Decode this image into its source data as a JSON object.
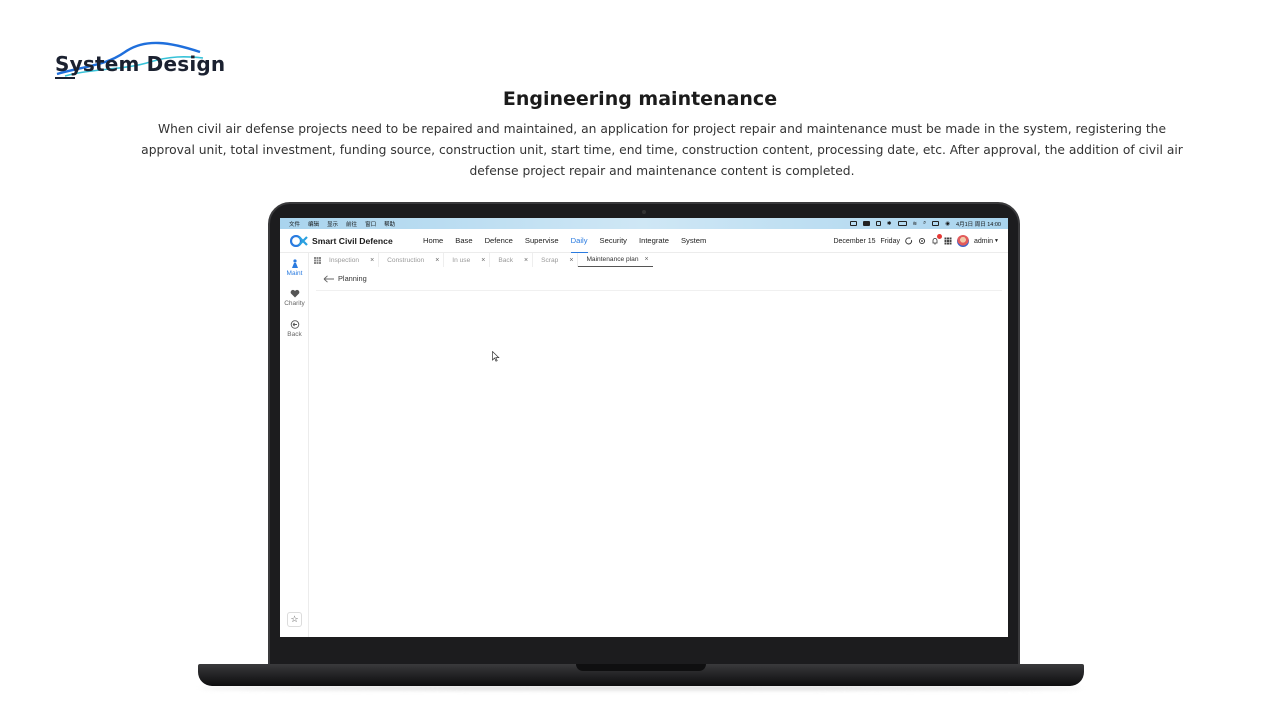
{
  "brand": {
    "title": "System Design"
  },
  "page": {
    "heading": "Engineering maintenance",
    "description": "When civil air defense projects need to be repaired and maintained, an application for project repair and maintenance must be made in the system, registering the approval unit, total investment, funding source, construction unit, start time, end time, construction content, processing date, etc. After approval, the addition of civil air defense project repair and maintenance content is completed."
  },
  "menubar": {
    "items": [
      "文件",
      "编辑",
      "显示",
      "前往",
      "窗口",
      "帮助"
    ],
    "clock": "4月1日 周日  14:00"
  },
  "app": {
    "name": "Smart Civil Defence",
    "nav": [
      "Home",
      "Base",
      "Defence",
      "Supervise",
      "Daily",
      "Security",
      "Integrate",
      "System"
    ],
    "active_nav": "Daily",
    "date": "December 15",
    "weekday": "Friday",
    "user": "admin",
    "accent_color": "#2a7be0"
  },
  "sidebar": {
    "items": [
      "Maint",
      "Charity",
      "Back"
    ]
  },
  "tabs": [
    "Inspection",
    "Construction",
    "In use",
    "Back",
    "Scrap",
    "Maintenance plan"
  ],
  "content": {
    "breadcrumb": "Planning"
  }
}
